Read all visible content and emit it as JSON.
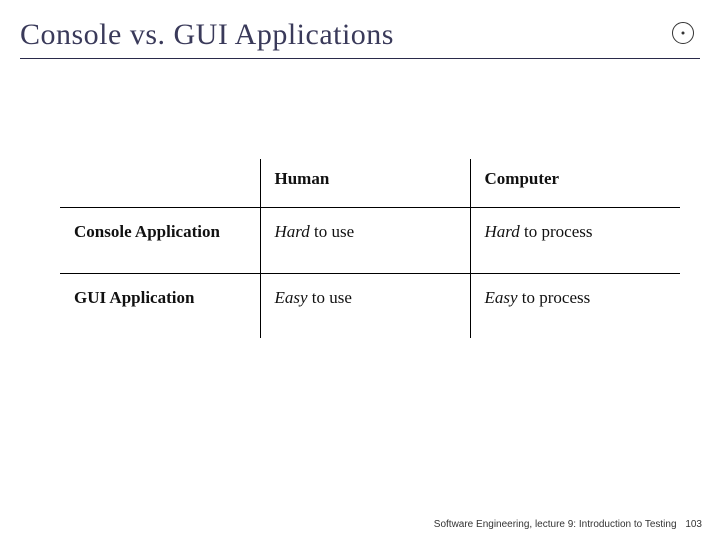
{
  "header": {
    "title": "Console vs. GUI Applications"
  },
  "table": {
    "headers": {
      "col1": "",
      "col2": "Human",
      "col3": "Computer"
    },
    "rows": [
      {
        "label": "Console Application",
        "human_em": "Hard",
        "human_rest": " to use",
        "computer_em": "Hard",
        "computer_rest": " to process"
      },
      {
        "label": "GUI Application",
        "human_em": "Easy",
        "human_rest": " to use",
        "computer_em": "Easy",
        "computer_rest": " to process"
      }
    ]
  },
  "footer": {
    "text": "Software Engineering, lecture 9: Introduction to Testing",
    "page": "103"
  }
}
